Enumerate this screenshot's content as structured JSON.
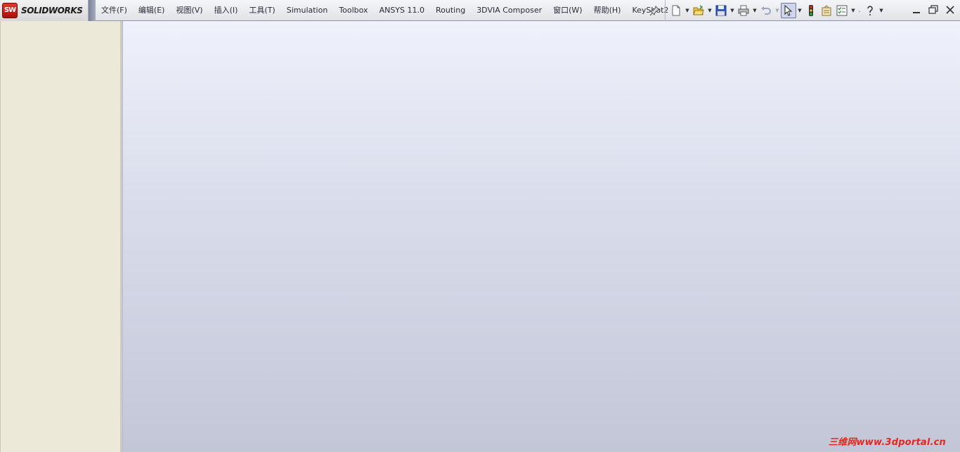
{
  "app": {
    "logo_mark": "SW",
    "logo_text": "SOLIDWORKS",
    "brand_color": "#c81e14"
  },
  "menu": [
    {
      "label": "文件(F)"
    },
    {
      "label": "编辑(E)"
    },
    {
      "label": "视图(V)"
    },
    {
      "label": "插入(I)"
    },
    {
      "label": "工具(T)"
    },
    {
      "label": "Simulation"
    },
    {
      "label": "Toolbox"
    },
    {
      "label": "ANSYS 11.0"
    },
    {
      "label": "Routing"
    },
    {
      "label": "3DVIA Composer"
    },
    {
      "label": "窗口(W)"
    },
    {
      "label": "帮助(H)"
    },
    {
      "label": "KeyShot2"
    }
  ],
  "toolbar": {
    "icons": [
      "pin-icon",
      "new-document-icon",
      "open-folder-icon",
      "save-icon",
      "print-icon",
      "undo-icon",
      "select-arrow-icon",
      "rebuild-traffic-light-icon",
      "file-properties-icon",
      "options-checklist-icon",
      "help-icon"
    ]
  },
  "window_controls": [
    "minimize-icon",
    "restore-icon",
    "close-icon"
  ],
  "watermark": {
    "text": "三维网www.3dportal.cn",
    "color": "#e4261c"
  }
}
